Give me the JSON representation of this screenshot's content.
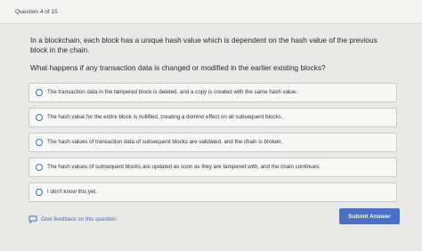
{
  "header": {
    "question_counter": "Question 4 of 15"
  },
  "prompt": "In a blockchain, each block has a unique hash value which is dependent on the hash value of the previous block in the chain.",
  "question": "What happens if any transaction data is changed or modified in the earlier existing blocks?",
  "options": [
    {
      "label": "The transaction data in the tampered block is deleted, and a copy is created with the same hash value."
    },
    {
      "label": "The hash value for the entire block is nullified, creating a domino effect on all subsequent blocks."
    },
    {
      "label": "The hash values of transaction data of subsequent blocks are validated, and the chain is broken."
    },
    {
      "label": "The hash values of subsequent blocks are updated as soon as they are tampered with, and the chain continues."
    },
    {
      "label": "I don't know this yet."
    }
  ],
  "footer": {
    "feedback_label": "Give feedback on this question",
    "submit_label": "Submit Answer"
  },
  "colors": {
    "accent": "#3a6fc4",
    "button": "#4a6fc9",
    "background": "#e9eae7"
  }
}
